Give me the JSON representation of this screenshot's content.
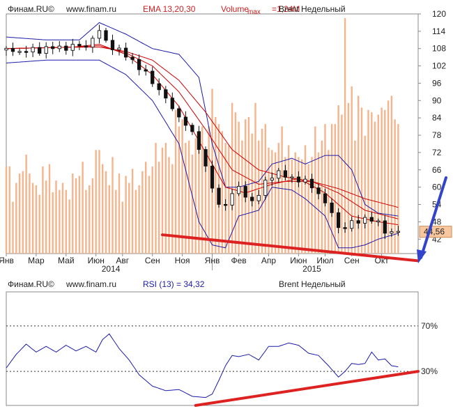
{
  "colors": {
    "frame": "#8a8a8a",
    "ema": "#cc0000",
    "bands": "#1a1aa8",
    "volume": "#f5b48c",
    "candle": "#111111",
    "annotation_red": "#dd2222",
    "annotation_blue": "#3344cc",
    "label_red": "#cc2222",
    "label_blue": "#1a1aa8",
    "price_box": "#f7c8a0",
    "rsi_line": "#1a1aa8"
  },
  "chart_data": [
    {
      "type": "line",
      "header": {
        "source": "Финам.RU©",
        "url": "www.finam.ru",
        "ema_label": "EMA 13,20,30",
        "volume_label": "Volume",
        "max_label": "max",
        "volume_max": "=1,24M",
        "instrument": "Brent Недельный"
      },
      "last_price_label": "44,56",
      "ylim": [
        37,
        120
      ],
      "yticks": [
        "120",
        "114",
        "108",
        "102",
        "96",
        "90",
        "84",
        "78",
        "72",
        "66",
        "60",
        "54",
        "48",
        "42"
      ],
      "ytick_values": [
        120,
        114,
        108,
        102,
        96,
        90,
        84,
        78,
        72,
        66,
        60,
        54,
        48,
        42
      ],
      "month_labels": [
        "Янв",
        "Мар",
        "Май",
        "Июн",
        "Авг",
        "Сен",
        "Ноя",
        "Янв",
        "Фев",
        "Апр",
        "Июн",
        "Июл",
        "Сен",
        "Окт"
      ],
      "month_weeks": [
        0,
        9,
        18,
        27,
        35,
        44,
        53,
        62,
        70,
        79,
        88,
        96,
        104,
        113
      ],
      "year_labels": [
        "2014",
        "2015"
      ],
      "year_weeks": [
        31.5,
        92
      ],
      "year_separator_week": 62,
      "price": {
        "week": [
          0,
          6,
          12,
          18,
          24,
          28,
          30,
          34,
          38,
          42,
          46,
          50,
          54,
          58,
          62,
          64,
          67,
          70,
          73,
          76,
          79,
          82,
          85,
          88,
          91,
          94,
          97,
          100,
          103,
          106,
          109,
          112,
          114,
          116,
          118
        ],
        "close": [
          107.5,
          107,
          108,
          108.5,
          109,
          114,
          110.5,
          107,
          104,
          99,
          94,
          87,
          82,
          74,
          60,
          53,
          56,
          60,
          55,
          57,
          64,
          65,
          63,
          63,
          61,
          58,
          53,
          46,
          47,
          48,
          50,
          47,
          45,
          44.5,
          44.56
        ]
      },
      "ema13": {
        "week": [
          0,
          20,
          28,
          36,
          44,
          52,
          60,
          66,
          72,
          80,
          88,
          96,
          104,
          112,
          118
        ],
        "value": [
          108,
          108.5,
          109.5,
          106,
          99,
          88,
          72,
          60,
          58,
          61,
          63,
          58,
          50,
          48,
          47
        ]
      },
      "ema20": {
        "week": [
          0,
          20,
          28,
          36,
          44,
          52,
          60,
          68,
          76,
          84,
          92,
          100,
          108,
          118
        ],
        "value": [
          108,
          108.5,
          109,
          106.5,
          102,
          93,
          80,
          66,
          61,
          62,
          62,
          58,
          52,
          49
        ]
      },
      "ema30": {
        "week": [
          0,
          20,
          28,
          36,
          44,
          52,
          60,
          68,
          76,
          84,
          92,
          100,
          108,
          118
        ],
        "value": [
          108,
          108.5,
          108.5,
          107,
          104,
          97,
          86,
          73,
          66,
          63.5,
          62,
          59.5,
          56,
          53
        ]
      },
      "bollinger_upper": {
        "week": [
          0,
          12,
          22,
          28,
          36,
          44,
          52,
          58,
          62,
          66,
          70,
          76,
          80,
          86,
          90,
          96,
          100,
          104,
          108,
          112,
          118
        ],
        "value": [
          112,
          111,
          111,
          117,
          113,
          108,
          106,
          98,
          75,
          60,
          60,
          62,
          68,
          70,
          68,
          71,
          71,
          66,
          54,
          51,
          50
        ]
      },
      "bollinger_lower": {
        "week": [
          0,
          12,
          22,
          28,
          36,
          44,
          52,
          58,
          62,
          66,
          70,
          76,
          80,
          86,
          90,
          96,
          100,
          104,
          108,
          112,
          118
        ],
        "value": [
          103,
          104,
          104,
          104,
          99,
          90,
          75,
          48,
          40,
          39,
          50,
          52,
          60,
          59,
          56,
          50,
          39,
          39,
          40,
          42,
          44
        ]
      },
      "volume_rel": [
        0.37,
        0.37,
        0.22,
        0.3,
        0.34,
        0.35,
        0.42,
        0.34,
        0.3,
        0.29,
        0.25,
        0.37,
        0.31,
        0.38,
        0.26,
        0.31,
        0.27,
        0.3,
        0.27,
        0.23,
        0.34,
        0.32,
        0.33,
        0.39,
        0.27,
        0.29,
        0.32,
        0.44,
        0.44,
        0.38,
        0.35,
        0.29,
        0.41,
        0.27,
        0.34,
        0.22,
        0.33,
        0.3,
        0.36,
        0.27,
        0.29,
        0.35,
        0.39,
        0.33,
        0.37,
        0.47,
        0.39,
        0.45,
        0.47,
        0.41,
        0.38,
        0.61,
        0.54,
        0.57,
        0.47,
        0.48,
        0.42,
        0.49,
        0.5,
        0.54,
        0.44,
        0.54,
        0.7,
        0.58,
        0.55,
        0.52,
        0.47,
        0.46,
        0.64,
        0.6,
        0.56,
        0.48,
        0.57,
        0.58,
        0.51,
        0.64,
        0.48,
        0.53,
        0.55,
        0.45,
        0.44,
        0.43,
        0.47,
        0.54,
        0.41,
        0.46,
        0.4,
        0.43,
        0.41,
        0.4,
        0.46,
        0.38,
        0.41,
        0.54,
        0.43,
        0.48,
        0.55,
        0.44,
        0.55,
        0.55,
        0.63,
        0.59,
        1.0,
        0.64,
        0.71,
        0.48,
        0.67,
        0.62,
        0.5,
        0.61,
        0.6,
        0.56,
        0.59,
        0.62,
        0.61,
        0.65,
        0.67,
        0.57,
        0.55
      ],
      "candle_step": 2,
      "support_line": {
        "from": [
          47,
          43.5
        ],
        "to": [
          124,
          34.5
        ]
      }
    },
    {
      "type": "line",
      "header": {
        "source": "Финам.RU©",
        "url": "www.finam.ru",
        "rsi_label": "RSI (13) = 34,32",
        "instrument": "Brent Недельный"
      },
      "ylim": [
        0,
        100
      ],
      "levels": [
        70,
        30
      ],
      "level_labels": [
        "70%",
        "30%"
      ],
      "rsi": {
        "week": [
          0,
          3,
          6,
          9,
          12,
          15,
          18,
          21,
          24,
          27,
          29,
          31,
          34,
          37,
          40,
          44,
          48,
          52,
          56,
          60,
          62,
          64,
          66,
          68,
          70,
          73,
          76,
          79,
          82,
          85,
          88,
          91,
          94,
          97,
          100,
          102,
          104,
          106,
          108,
          110,
          112,
          114,
          116,
          118
        ],
        "value": [
          33,
          45,
          54,
          47,
          52,
          47,
          53,
          48,
          52,
          47,
          58,
          63,
          50,
          40,
          27,
          17,
          13,
          14,
          8,
          7,
          10,
          22,
          35,
          44,
          43,
          45,
          40,
          52,
          52,
          55,
          53,
          46,
          44,
          35,
          25,
          30,
          37,
          36,
          37,
          47,
          40,
          41,
          35,
          34
        ]
      },
      "trend_line": {
        "from": [
          57,
          0
        ],
        "to": [
          124,
          30
        ]
      }
    }
  ]
}
